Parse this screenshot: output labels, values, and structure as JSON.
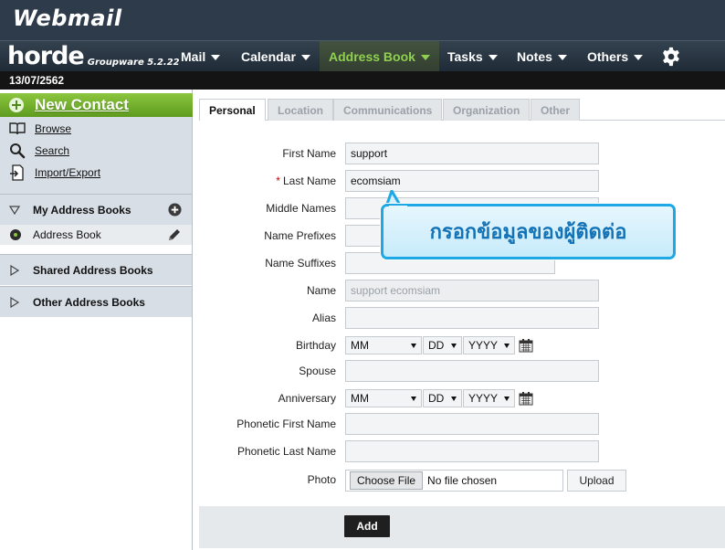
{
  "brand": {
    "title": "Webmail"
  },
  "horde": {
    "name": "horde",
    "subtitle": "Groupware 5.2.22"
  },
  "menu": [
    {
      "label": "Mail"
    },
    {
      "label": "Calendar"
    },
    {
      "label": "Address Book",
      "active": true
    },
    {
      "label": "Tasks"
    },
    {
      "label": "Notes"
    },
    {
      "label": "Others"
    }
  ],
  "date": "13/07/2562",
  "sidebar": {
    "new_contact": "New Contact",
    "links": [
      {
        "label": "Browse",
        "icon": "book-icon"
      },
      {
        "label": "Search",
        "icon": "magnifier-icon"
      },
      {
        "label": "Import/Export",
        "icon": "import-export-icon"
      }
    ],
    "my_address_books": "My Address Books",
    "address_book": "Address Book",
    "shared_address_books": "Shared Address Books",
    "other_address_books": "Other Address Books"
  },
  "tabs": [
    {
      "label": "Personal",
      "active": true
    },
    {
      "label": "Location"
    },
    {
      "label": "Communications"
    },
    {
      "label": "Organization"
    },
    {
      "label": "Other"
    }
  ],
  "form": {
    "first_name": {
      "label": "First Name",
      "value": "support"
    },
    "last_name": {
      "label": "Last Name",
      "value": "ecomsiam",
      "required": "*"
    },
    "middle_names": {
      "label": "Middle Names",
      "value": ""
    },
    "name_prefixes": {
      "label": "Name Prefixes",
      "value": ""
    },
    "name_suffixes": {
      "label": "Name Suffixes",
      "value": ""
    },
    "name": {
      "label": "Name",
      "value": "support ecomsiam"
    },
    "alias": {
      "label": "Alias",
      "value": ""
    },
    "birthday": {
      "label": "Birthday",
      "month": "MM",
      "day": "DD",
      "year": "YYYY"
    },
    "spouse": {
      "label": "Spouse",
      "value": ""
    },
    "anniversary": {
      "label": "Anniversary",
      "month": "MM",
      "day": "DD",
      "year": "YYYY"
    },
    "phonetic_first_name": {
      "label": "Phonetic First Name",
      "value": ""
    },
    "phonetic_last_name": {
      "label": "Phonetic Last Name",
      "value": ""
    },
    "photo": {
      "label": "Photo",
      "choose_button": "Choose File",
      "file_status": "No file chosen",
      "upload_button": "Upload"
    }
  },
  "add_button": "Add",
  "callout": {
    "text": "กรอกข้อมูลของผู้ติดต่อ"
  },
  "colors": {
    "accent_green": "#8cc63f",
    "header_dark": "#2e3b4a",
    "callout_border": "#1fa8e6",
    "callout_text": "#1473b7"
  }
}
